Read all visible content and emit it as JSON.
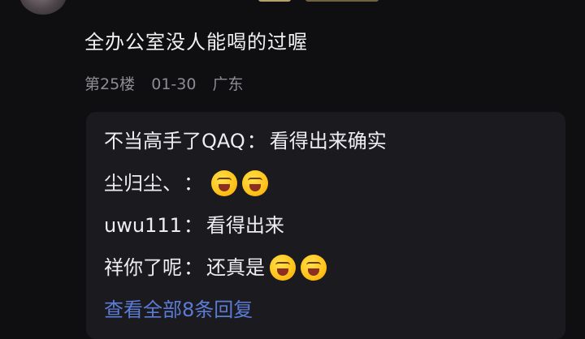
{
  "comment": {
    "text": "全办公室没人能喝的过喔",
    "floor": "第25楼",
    "date": "01-30",
    "location": "广东"
  },
  "replies": [
    {
      "name": "不当高手了QAQ",
      "sep": "：",
      "text": "看得出来确实",
      "emojis": 0
    },
    {
      "name": "尘归尘、",
      "sep": "：",
      "text": "",
      "emojis": 2
    },
    {
      "name": "uwu111",
      "sep": "：",
      "text": "看得出来",
      "emojis": 0
    },
    {
      "name": "祥你了呢",
      "sep": "：",
      "text": "还真是",
      "emojis": 2
    }
  ],
  "view_all": "查看全部8条回复",
  "icons": {
    "laughing_emoji": "laughing-emoji-icon"
  },
  "colors": {
    "background": "#0f0f11",
    "reply_box": "#1b1b1f",
    "link": "#5b7bd6",
    "meta": "#8c8c92"
  }
}
